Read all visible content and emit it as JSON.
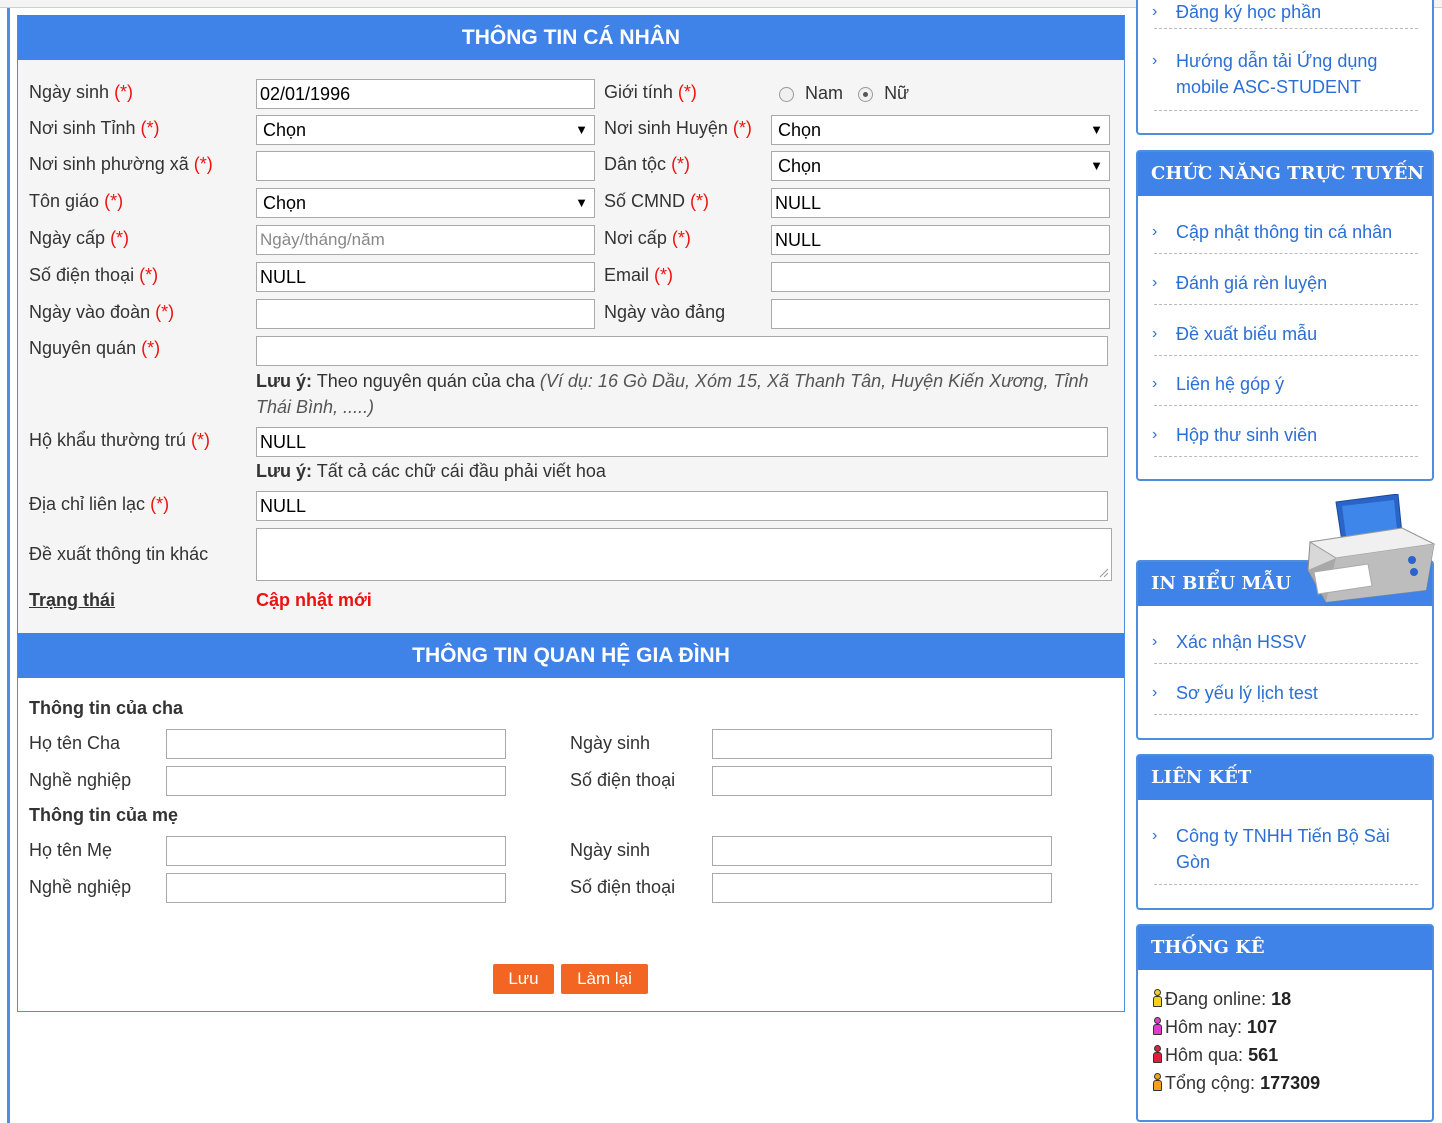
{
  "personal": {
    "header": "THÔNG TIN CÁ NHÂN",
    "req_mark": "(*)",
    "ngay_sinh_label": "Ngày sinh",
    "ngay_sinh_value": "02/01/1996",
    "gioi_tinh_label": "Giới tính",
    "gender_nam": "Nam",
    "gender_nu": "Nữ",
    "gender_selected": "Nữ",
    "noi_sinh_tinh_label": "Nơi sinh Tỉnh",
    "noi_sinh_tinh_value": "Chọn",
    "noi_sinh_huyen_label": "Nơi sinh Huyện",
    "noi_sinh_huyen_value": "Chọn",
    "noi_sinh_px_label": "Nơi sinh phường xã",
    "noi_sinh_px_value": "",
    "dan_toc_label": "Dân tộc",
    "dan_toc_value": "Chọn",
    "ton_giao_label": "Tôn giáo",
    "ton_giao_value": "Chọn",
    "cmnd_label": "Số CMND",
    "cmnd_value": "NULL",
    "ngay_cap_label": "Ngày cấp",
    "ngay_cap_placeholder": "Ngày/tháng/năm",
    "noi_cap_label": "Nơi cấp",
    "noi_cap_value": "NULL",
    "sdt_label": "Số điện thoại",
    "sdt_value": "NULL",
    "email_label": "Email",
    "email_value": "",
    "ngay_vao_doan_label": "Ngày vào đoàn",
    "ngay_vao_dang_label": "Ngày vào đảng",
    "nguyen_quan_label": "Nguyên quán",
    "note_bold": "Lưu ý:",
    "nguyen_quan_note": "Theo nguyên quán của cha",
    "nguyen_quan_example": "(Ví dụ: 16 Gò Dầu, Xóm 15, Xã Thanh Tân, Huyện Kiến Xương, Tỉnh Thái Bình, .....)",
    "ho_khau_label": "Hộ khẩu thường trú",
    "ho_khau_value": "NULL",
    "ho_khau_note": "Tất cả các chữ cái đầu phải viết hoa",
    "dia_chi_label": "Địa chỉ liên lạc",
    "dia_chi_value": "NULL",
    "de_xuat_label": "Đề xuất thông tin khác",
    "trang_thai_label": "Trạng thái",
    "trang_thai_value": "Cập nhật mới"
  },
  "family": {
    "header": "THÔNG TIN QUAN HỆ GIA ĐÌNH",
    "father_title": "Thông tin của cha",
    "mother_title": "Thông tin của mẹ",
    "ho_ten_cha": "Họ tên Cha",
    "ho_ten_me": "Họ tên Mẹ",
    "nghe_nghiep": "Nghề nghiệp",
    "ngay_sinh": "Ngày sinh",
    "so_dien_thoai": "Số điện thoại"
  },
  "buttons": {
    "save": "Lưu",
    "reset": "Làm lại"
  },
  "sidebar": {
    "top_links": [
      "Đăng ký học phần",
      "Hướng dẫn tải Ứng dụng mobile ASC-STUDENT"
    ],
    "online": {
      "title": "CHỨC NĂNG TRỰC TUYẾN",
      "items": [
        "Cập nhật thông tin cá nhân",
        "Đánh giá rèn luyện",
        "Đề xuất biểu mẫu",
        "Liên hệ góp ý",
        "Hộp thư sinh viên"
      ]
    },
    "print": {
      "title": "IN BIỂU MẪU",
      "items": [
        "Xác nhận HSSV",
        "Sơ yếu lý lịch test"
      ]
    },
    "links": {
      "title": "LIÊN KẾT",
      "items": [
        "Công ty TNHH Tiến Bộ Sài Gòn"
      ]
    },
    "stats": {
      "title": "THỐNG KÊ",
      "online_label": "Đang online:",
      "online_value": "18",
      "today_label": "Hôm nay:",
      "today_value": "107",
      "yesterday_label": "Hôm qua:",
      "yesterday_value": "561",
      "total_label": "Tổng cộng:",
      "total_value": "177309"
    }
  },
  "colors": {
    "header_blue": "#3f82e8",
    "required_red": "#e11111",
    "button_orange": "#f26522",
    "link_blue": "#2b6fd6"
  }
}
